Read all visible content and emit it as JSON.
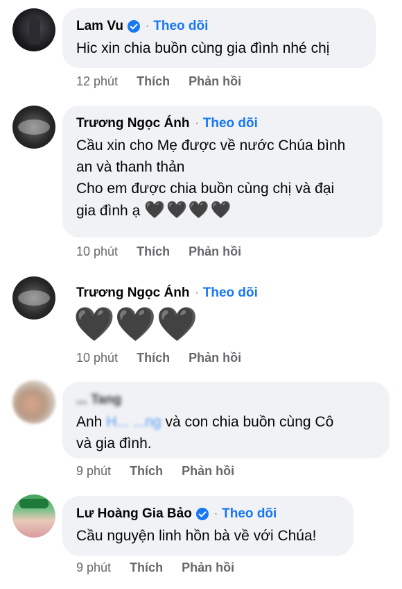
{
  "comments": [
    {
      "author": "Lam Vu",
      "verified": true,
      "follow": "Theo dõi",
      "lines": [
        "Hic xin chia buồn cùng gia đình nhé chị"
      ],
      "time": "12 phút",
      "like": "Thích",
      "reply": "Phản hồi"
    },
    {
      "author": "Trương Ngọc Ánh",
      "verified": false,
      "follow": "Theo dõi",
      "lines": [
        "Cầu xin cho Mẹ được về nước Chúa bình",
        "an và thanh thản",
        "Cho em được chia buồn cùng chị và đại",
        "gia đình ạ"
      ],
      "hearts": "🖤🖤🖤🖤",
      "time": "10 phút",
      "like": "Thích",
      "reply": "Phản hồi"
    },
    {
      "author": "Trương Ngọc Ánh",
      "verified": false,
      "follow": "Theo dõi",
      "hearts": "🖤🖤🖤",
      "time": "10 phút",
      "like": "Thích",
      "reply": "Phản hồi"
    },
    {
      "author": "... Tang",
      "verified": false,
      "text_prefix": "Anh",
      "mention": "H... ...ng",
      "text_suffix": "và con chia buồn cùng Cô",
      "line2": "và gia đình.",
      "time": "9 phút",
      "like": "Thích",
      "reply": "Phản hồi"
    },
    {
      "author": "Lư Hoàng Gia Bảo",
      "verified": true,
      "follow": "Theo dõi",
      "lines": [
        "Cầu nguyện linh hồn bà về với Chúa!"
      ],
      "time": "9 phút",
      "like": "Thích",
      "reply": "Phản hồi"
    }
  ],
  "icons": {
    "verified": "verified-badge-icon",
    "heart": "black-heart-icon"
  },
  "colors": {
    "bubble": "#f0f2f5",
    "link": "#1877f2",
    "meta": "#65676b",
    "verified": "#1877f2"
  }
}
